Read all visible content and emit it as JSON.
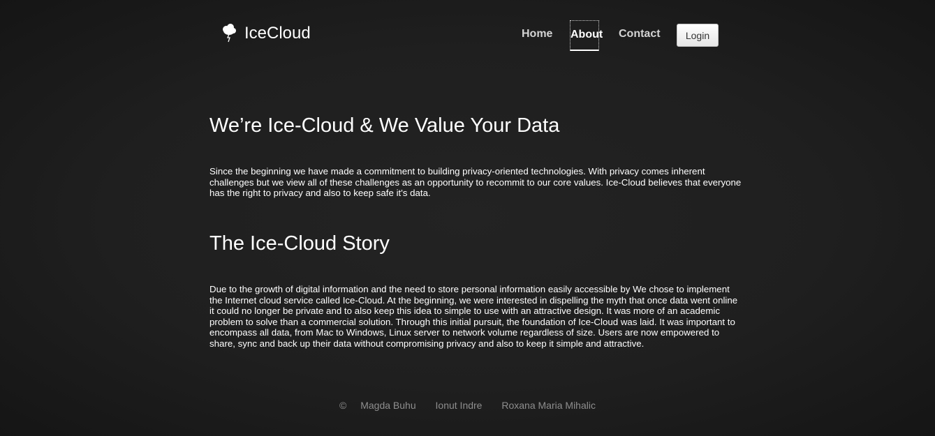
{
  "header": {
    "brand": "IceCloud",
    "nav": [
      {
        "label": "Home"
      },
      {
        "label": "About"
      },
      {
        "label": "Contact"
      }
    ],
    "login_label": "Login"
  },
  "main": {
    "sections": [
      {
        "title": "We’re Ice-Cloud & We Value Your Data",
        "body": "Since the beginning we have made a commitment to building privacy-oriented technologies. With privacy comes inherent challenges but we view all of these challenges as an opportunity to recommit to our core values. Ice-Cloud believes that everyone has the right to privacy and also to keep safe it's data."
      },
      {
        "title": "The Ice-Cloud Story",
        "body": "Due to the growth of digital information and the need to store personal information easily accessible by We chose to implement the Internet cloud service called Ice-Cloud. At the beginning, we were interested in dispelling the myth that once data went online it could no longer be private and to also keep this idea to simple to use with an attractive design. It was more of an academic problem to solve than a commercial solution. Through this initial pursuit, the foundation of Ice-Cloud was laid. It was important to encompass all data, from Mac to Windows, Linux server to network volume regardless of size. Users are now empowered to share, sync and back up their data without compromising privacy and also to keep it simple and attractive."
      }
    ]
  },
  "footer": {
    "copyright": "©",
    "authors": [
      "Magda Buhu",
      "Ionut Indre",
      "Roxana Maria Mihalic"
    ]
  },
  "icons": {
    "brand": "cloud-lightning-icon"
  },
  "colors": {
    "background": "#1f1f1f",
    "text": "#ffffff",
    "nav_text": "#d4d4d4",
    "footer_text": "#8e8e8e"
  }
}
